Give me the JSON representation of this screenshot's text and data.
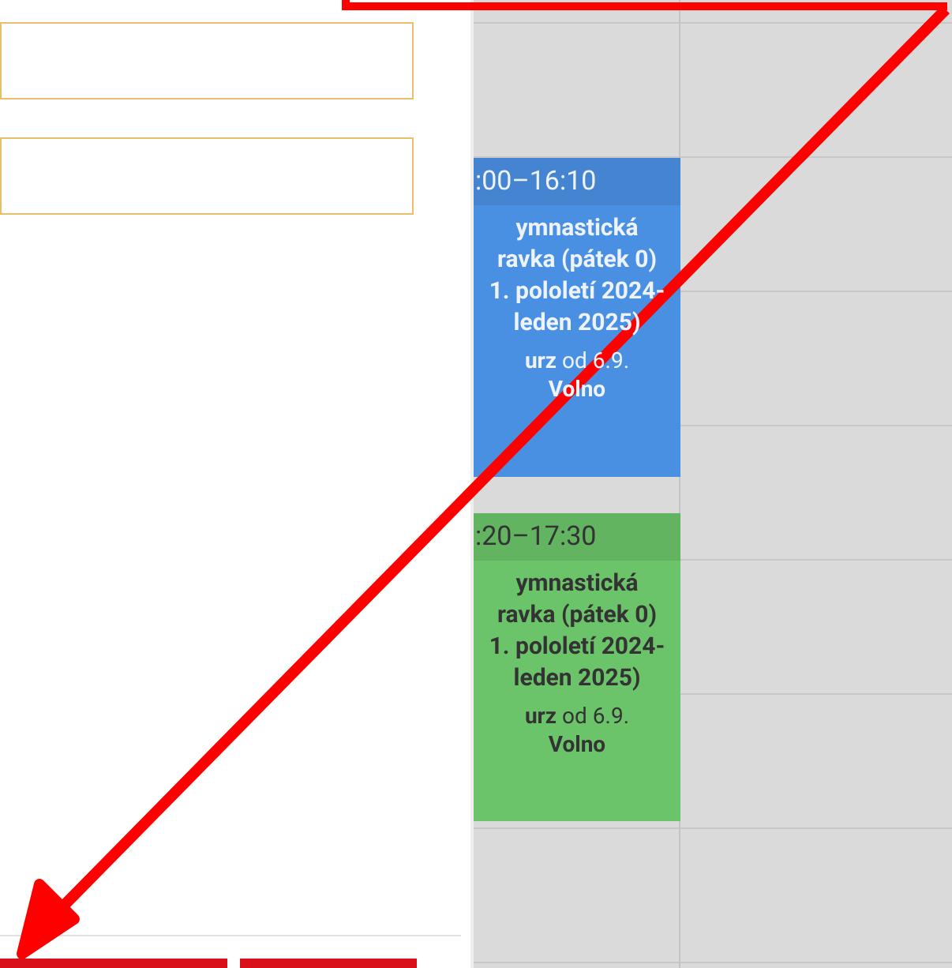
{
  "calendar": {
    "events": [
      {
        "time": ":00–16:10",
        "title": "ymnastická ravka (pátek 0) 1. pololetí 2024- leden 2025)",
        "course": "**urz** od 6.9.",
        "status": "Volno",
        "color": "#4a90e2",
        "light_text": true
      },
      {
        "time": ":20–17:30",
        "title": "ymnastická ravka (pátek 0) 1. pololetí 2024- leden 2025)",
        "course": "**urz** od 6.9.",
        "status": "Volno",
        "color": "#6cc46a",
        "light_text": false
      }
    ]
  }
}
